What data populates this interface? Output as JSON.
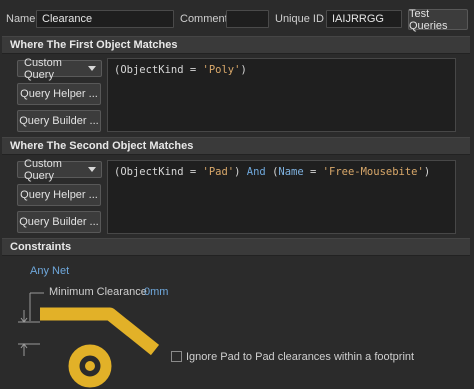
{
  "header": {
    "name_label": "Name",
    "name_value": "Clearance",
    "comment_label": "Comment",
    "comment_value": "",
    "uid_label": "Unique ID",
    "uid_value": "IAIJRRGG",
    "test_button": "Test Queries"
  },
  "first_match": {
    "title": "Where The First Object Matches",
    "dropdown_value": "Custom Query",
    "query_helper": "Query Helper ...",
    "query_builder": "Query Builder ...",
    "query_parts": {
      "open": "(ObjectKind = ",
      "str": "'Poly'",
      "close": ")"
    }
  },
  "second_match": {
    "title": "Where The Second Object Matches",
    "dropdown_value": "Custom Query",
    "query_helper": "Query Helper ...",
    "query_builder": "Query Builder ...",
    "query_parts": {
      "p1": "(ObjectKind = ",
      "s1": "'Pad'",
      "p2": ") ",
      "kw": "And",
      "p3": " (",
      "var": "Name",
      "p4": " = ",
      "s2": "'Free-Mousebite'",
      "p5": ")"
    }
  },
  "constraints": {
    "title": "Constraints",
    "net_label": "Any Net",
    "min_clearance_label": "Minimum Clearance",
    "min_clearance_value": "0mm",
    "ignore_pad_label": "Ignore Pad to Pad clearances within a footprint",
    "ignore_pad_checked": false
  },
  "colors": {
    "accent_blue": "#6fa8dc",
    "copper": "#e2b128",
    "string": "#d9a86a"
  }
}
